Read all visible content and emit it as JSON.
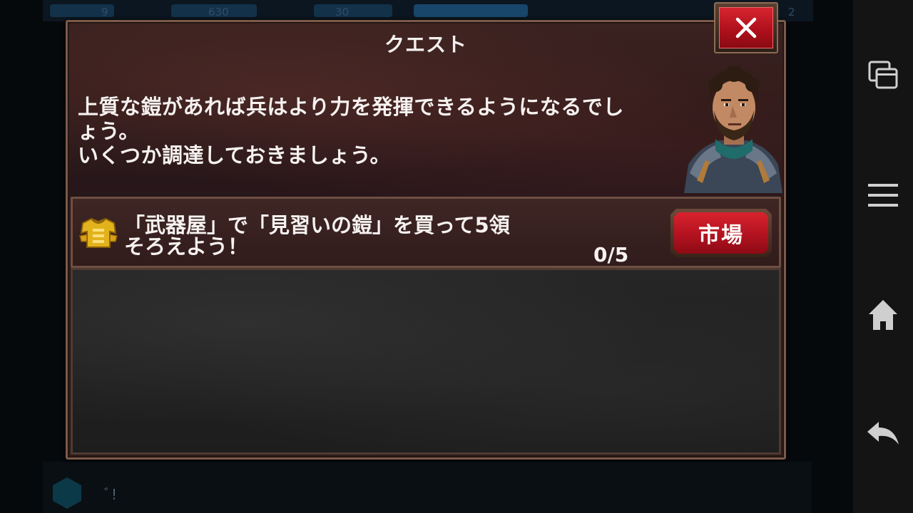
{
  "dialog": {
    "title": "クエスト",
    "message_line1": "上質な鎧があれば兵はより力を発揮できるようになるでし",
    "message_line2": "ょう。",
    "message_line3": "いくつか調達しておきましょう。",
    "close_label": "×",
    "portrait": "advisor-portrait"
  },
  "quest": {
    "icon": "armor-icon",
    "line1": "「武器屋」で「見習いの鎧」を買って5領",
    "line2": "そろえよう！",
    "progress": "0/5",
    "market_button_label": "市場"
  },
  "background": {
    "hud_values": [
      "9",
      "630",
      "30"
    ],
    "hud_right_value": "2",
    "bottom_text": "ﾞ!"
  },
  "nav_bar": {
    "icons": [
      "recent-apps-icon",
      "menu-icon",
      "home-icon",
      "back-icon"
    ]
  },
  "colors": {
    "accent_red": "#c0141f",
    "frame_brown": "#7c5a4a",
    "panel_bg": "#2c1a18",
    "text": "#f6f2f0"
  }
}
